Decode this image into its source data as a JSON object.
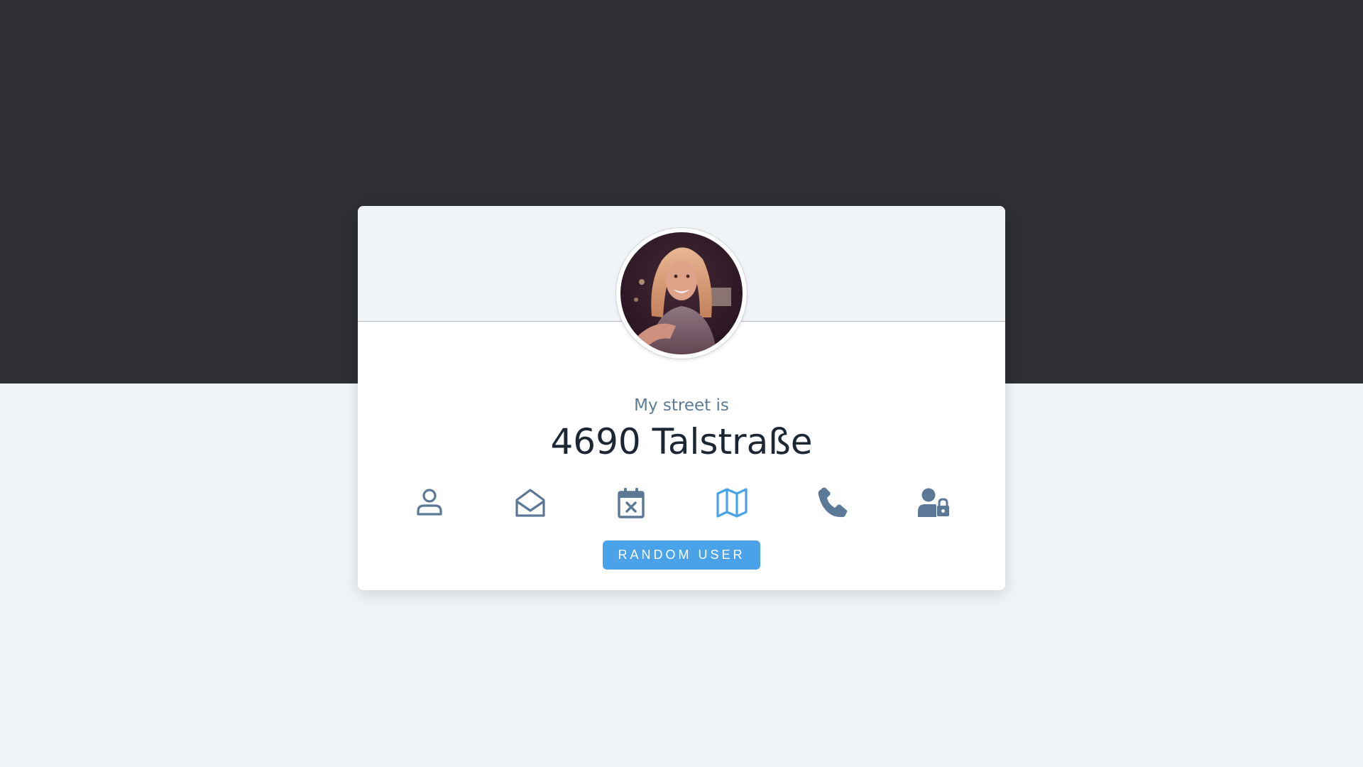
{
  "card": {
    "label": "My street is",
    "value": "4690 Talstraße",
    "active_icon": "map-icon",
    "colors": {
      "icon_default": "#5b7896",
      "icon_active": "#4aa3e8",
      "button": "#4aa3e8",
      "header_bg": "#f1f4f7",
      "top_band": "#2d2f34"
    },
    "icons": [
      "user-icon",
      "envelope-open-icon",
      "calendar-x-icon",
      "map-icon",
      "phone-icon",
      "user-lock-icon"
    ]
  },
  "random_button": {
    "label": "RANDOM USER"
  }
}
